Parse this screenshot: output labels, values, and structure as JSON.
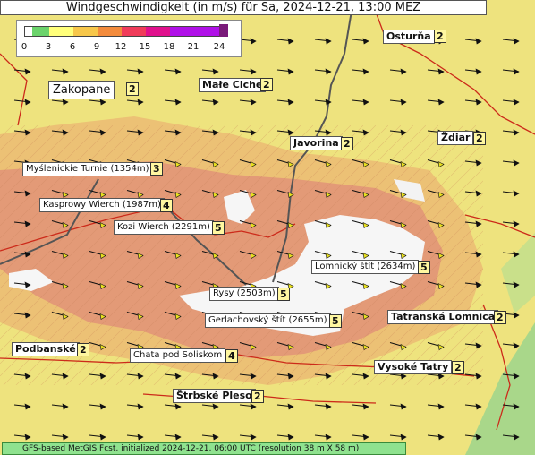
{
  "title": "Windgeschwindigkeit (in m/s) für Sa, 2024-12-21, 13:00 MEZ",
  "legend": {
    "ticks": [
      "0",
      "3",
      "6",
      "9",
      "12",
      "15",
      "18",
      "21",
      "24"
    ],
    "colors": [
      "#ffffff",
      "#6bd36b",
      "#ffff7a",
      "#f7c74a",
      "#f38b3c",
      "#f03c5a",
      "#e0108c",
      "#b010e8",
      "#6a1aa0"
    ]
  },
  "places": [
    {
      "name": "Osturňa",
      "value": "2"
    },
    {
      "name": "Zakopane",
      "value": "2"
    },
    {
      "name": "Małe Ciche",
      "value": "2"
    },
    {
      "name": "Ždiar",
      "value": "2"
    },
    {
      "name": "Javorina",
      "value": "2"
    },
    {
      "name": "Myślenickie Turnie (1354m)",
      "value": "3"
    },
    {
      "name": "Kasprowy Wierch (1987m)",
      "value": "4"
    },
    {
      "name": "Kozi Wierch (2291m)",
      "value": "5"
    },
    {
      "name": "Lomnický štít (2634m)",
      "value": "5"
    },
    {
      "name": "Rysy (2503m)",
      "value": "5"
    },
    {
      "name": "Gerlachovský štít (2655m)",
      "value": "5"
    },
    {
      "name": "Tatranská Lomnica",
      "value": "2"
    },
    {
      "name": "Podbanské",
      "value": "2"
    },
    {
      "name": "Chata pod Soliskom",
      "value": "4"
    },
    {
      "name": "Vysoké Tatry",
      "value": "2"
    },
    {
      "name": "Štrbské Pleso",
      "value": "2"
    }
  ],
  "footer": "GFS-based MetGIS Fcst, initialized 2024-12-21, 06:00 UTC  (resolution 38 m X 58 m)",
  "colors": {
    "plain": "#eee37e",
    "hills": "#e9b070",
    "mountain": "#e08a70",
    "snow": "#f6f6f6",
    "green": "#a9d78a",
    "border": "#cc2a1a",
    "road": "#555555"
  }
}
